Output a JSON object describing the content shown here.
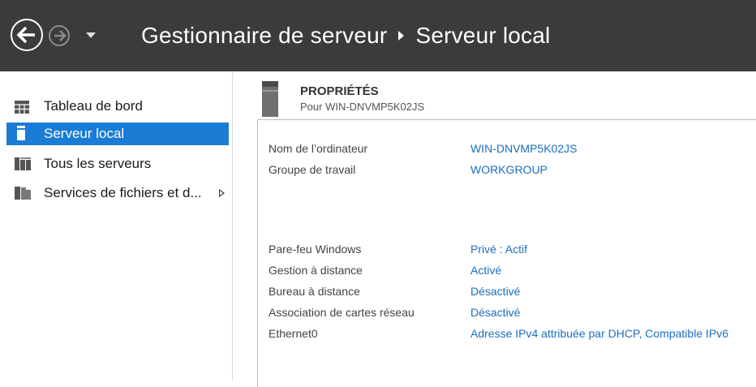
{
  "header": {
    "breadcrumb_root": "Gestionnaire de serveur",
    "breadcrumb_current": "Serveur local"
  },
  "sidebar": {
    "items": [
      {
        "label": "Tableau de bord",
        "icon": "dashboard-icon"
      },
      {
        "label": "Serveur local",
        "icon": "server-icon",
        "active": true
      },
      {
        "label": "Tous les serveurs",
        "icon": "servers-icon"
      },
      {
        "label": "Services de fichiers et d...",
        "icon": "file-services-icon"
      }
    ]
  },
  "properties": {
    "title": "PROPRIÉTÉS",
    "subtitle": "Pour WIN-DNVMP5K02JS",
    "rows": [
      {
        "key": "Nom de l’ordinateur",
        "value": "WIN-DNVMP5K02JS"
      },
      {
        "key": "Groupe de travail",
        "value": "WORKGROUP"
      },
      {
        "key": "Pare-feu Windows",
        "value": "Privé : Actif"
      },
      {
        "key": "Gestion à distance",
        "value": "Activé"
      },
      {
        "key": "Bureau à distance",
        "value": "Désactivé"
      },
      {
        "key": "Association de cartes réseau",
        "value": "Désactivé"
      },
      {
        "key": "Ethernet0",
        "value": "Adresse IPv4 attribuée par DHCP, Compatible IPv6"
      }
    ]
  },
  "colors": {
    "header_bg": "#3b3b3b",
    "active_bg": "#1a7cd4",
    "link": "#1a6fc0"
  }
}
